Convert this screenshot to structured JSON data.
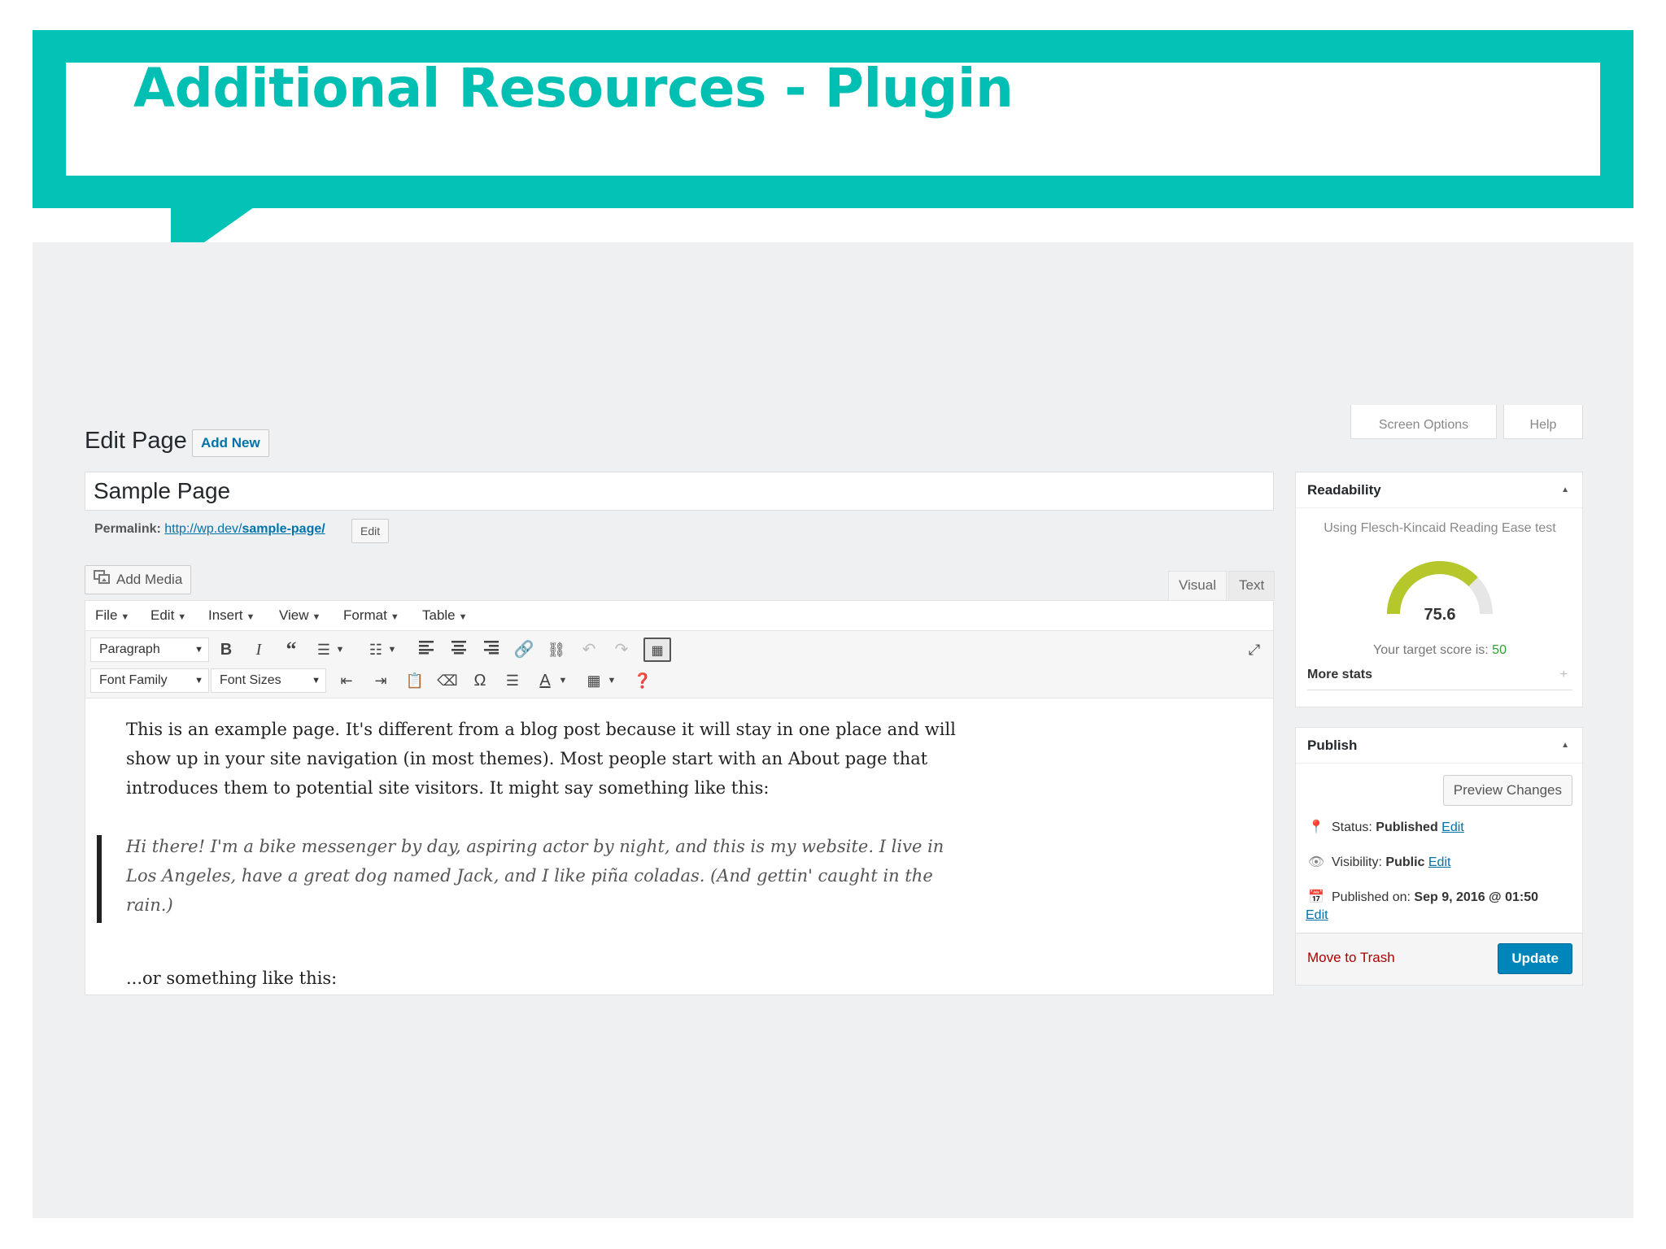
{
  "slide": {
    "title": "Additional Resources - Plugin"
  },
  "topbar": {
    "screen_options": "Screen Options",
    "help": "Help"
  },
  "page": {
    "heading": "Edit Page",
    "add_new": "Add New"
  },
  "post": {
    "title": "Sample Page",
    "permalink_label": "Permalink:",
    "permalink_base": "http://wp.dev/",
    "permalink_slug": "sample-page/",
    "permalink_edit": "Edit"
  },
  "media": {
    "add_media": "Add Media"
  },
  "editor_tabs": {
    "visual": "Visual",
    "text": "Text"
  },
  "menubar": [
    "File",
    "Edit",
    "Insert",
    "View",
    "Format",
    "Table"
  ],
  "toolbar": {
    "paragraph": "Paragraph",
    "font_family": "Font Family",
    "font_sizes": "Font Sizes"
  },
  "content": {
    "para1": "This is an example page. It's different from a blog post because it will stay in one place and will show up in your site navigation (in most themes). Most people start with an About page that introduces them to potential site visitors. It might say something like this:",
    "quote": "Hi there! I'm a bike messenger by day, aspiring actor by night, and this is my website. I live in Los Angeles, have a great dog named Jack, and I like piña coladas. (And gettin' caught in the rain.)",
    "para2": "...or something like this:"
  },
  "readability": {
    "title": "Readability",
    "subtitle": "Using Flesch-Kincaid Reading Ease test",
    "score": "75.6",
    "score_fraction": 0.756,
    "target_label": "Your target score is:",
    "target_value": "50",
    "more_stats": "More stats",
    "gauge_color": "#b5c72a",
    "target_color": "#2ea22e"
  },
  "publish": {
    "title": "Publish",
    "preview": "Preview Changes",
    "status_label": "Status:",
    "status_value": "Published",
    "visibility_label": "Visibility:",
    "visibility_value": "Public",
    "published_label": "Published on:",
    "published_value": "Sep 9, 2016 @ 01:50",
    "edit": "Edit",
    "trash": "Move to Trash",
    "update": "Update"
  },
  "colors": {
    "accent": "#02c3b5",
    "link": "#0073aa",
    "primary_button": "#0085ba"
  }
}
